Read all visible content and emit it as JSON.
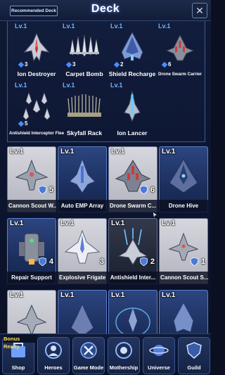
{
  "header": {
    "recommended_label": "Recommended Deck",
    "title": "Deck",
    "close_label": "✕"
  },
  "deck": [
    {
      "level": "Lv.1",
      "count": "3",
      "name": "Ion Destroyer",
      "icon": "ion-destroyer-ship-icon"
    },
    {
      "level": "Lv.1",
      "count": "3",
      "name": "Carpet Bomb",
      "icon": "carpet-bomb-fleet-icon"
    },
    {
      "level": "Lv.1",
      "count": "2",
      "name": "Shield Recharge",
      "icon": "shield-recharge-ship-icon"
    },
    {
      "level": "Lv.1",
      "count": "6",
      "name": "Drone Swarm Carrier",
      "icon": "drone-swarm-carrier-icon"
    },
    {
      "level": "Lv.1",
      "count": "5",
      "name": "Antishield Interceptor Fleet",
      "icon": "antishield-interceptor-fleet-icon"
    },
    {
      "level": "Lv.1",
      "count": "",
      "name": "Skyfall Rack",
      "icon": "skyfall-rack-icon"
    },
    {
      "level": "Lv.1",
      "count": "",
      "name": "Ion Lancer",
      "icon": "ion-lancer-ship-icon"
    }
  ],
  "cards": [
    {
      "level": "Lv.1",
      "count": "5",
      "name": "Cannon Scout W...",
      "style": "grey",
      "icon": "cannon-scout-ship-icon"
    },
    {
      "level": "Lv.1",
      "count": "",
      "name": "Auto EMP Array",
      "style": "blue",
      "icon": "auto-emp-array-icon"
    },
    {
      "level": "Lv.1",
      "count": "6",
      "name": "Drone Swarm C...",
      "style": "grey",
      "icon": "drone-swarm-carrier-icon"
    },
    {
      "level": "Lv.1",
      "count": "",
      "name": "Drone Hive",
      "style": "blue",
      "icon": "drone-hive-icon"
    },
    {
      "level": "Lv.1",
      "count": "4",
      "name": "Repair Support",
      "style": "blue",
      "icon": "repair-support-ship-icon"
    },
    {
      "level": "Lv.1",
      "count": "3",
      "name": "Explosive Frigate",
      "style": "grey",
      "icon": "explosive-frigate-icon"
    },
    {
      "level": "Lv.1",
      "count": "2",
      "name": "Antishield Inter...",
      "style": "dark",
      "icon": "antishield-interceptor-icon"
    },
    {
      "level": "Lv.1",
      "count": "1",
      "name": "Cannon Scout S...",
      "style": "grey",
      "icon": "cannon-scout-ship-icon"
    },
    {
      "level": "Lv.1",
      "count": "",
      "name": "",
      "style": "grey",
      "icon": "fighter-ship-icon"
    },
    {
      "level": "Lv.1",
      "count": "",
      "name": "",
      "style": "blue",
      "icon": "cruiser-ship-icon"
    },
    {
      "level": "Lv.1",
      "count": "",
      "name": "",
      "style": "blue",
      "icon": "shield-ship-icon"
    },
    {
      "level": "Lv.1",
      "count": "",
      "name": "",
      "style": "blue",
      "icon": "warship-icon"
    }
  ],
  "nav": {
    "bonus_label": "Bonus Ready",
    "items": [
      {
        "label": "Shop",
        "icon": "shop-icon"
      },
      {
        "label": "Heroes",
        "icon": "heroes-icon"
      },
      {
        "label": "Game Mode",
        "icon": "game-mode-icon"
      },
      {
        "label": "Mothership",
        "icon": "mothership-icon"
      },
      {
        "label": "Universe",
        "icon": "universe-icon"
      },
      {
        "label": "Guild",
        "icon": "guild-icon"
      }
    ]
  },
  "colors": {
    "level_text": "#6fb3ff",
    "bonus_text": "#ffe14a",
    "panel_border": "#3b5a92"
  }
}
